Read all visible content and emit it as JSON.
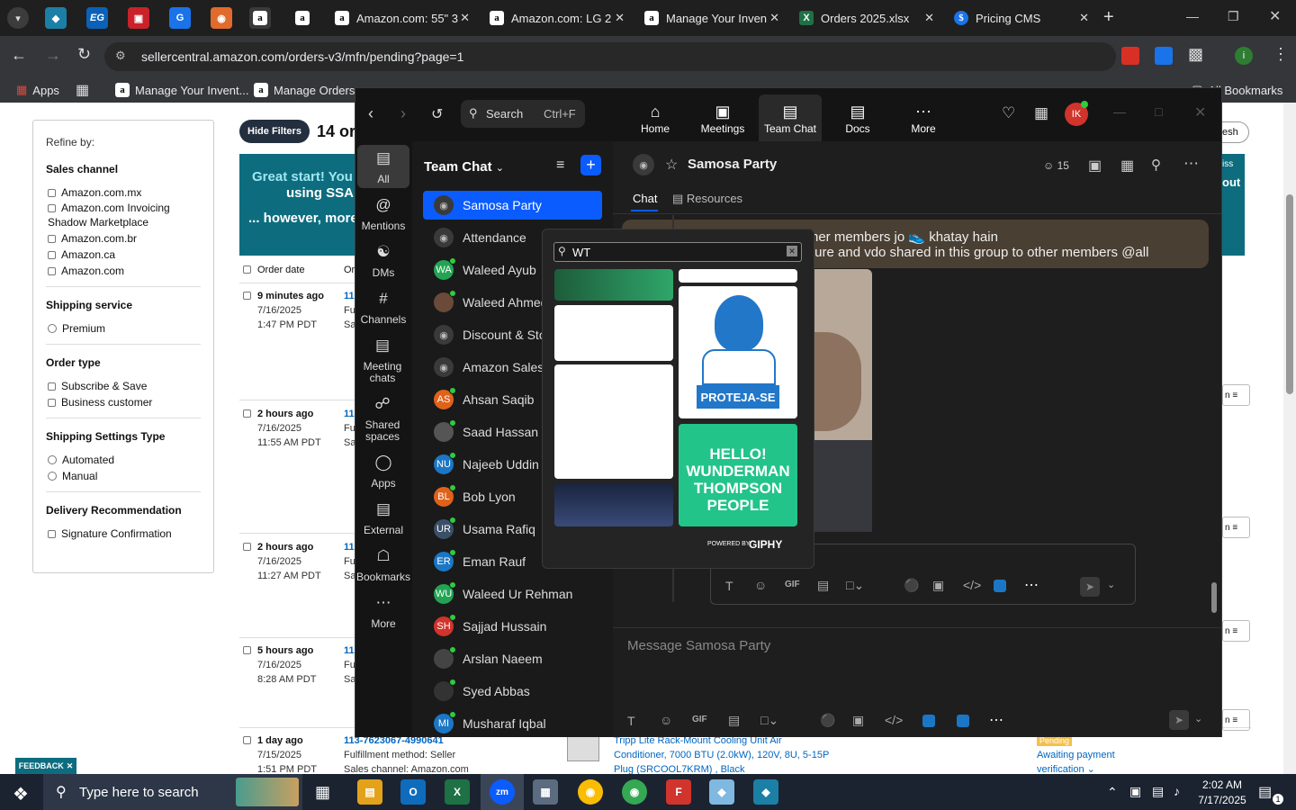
{
  "browser": {
    "tabs": [
      {
        "title": "Amazon.com: 55\" 3"
      },
      {
        "title": "Amazon.com: LG 2"
      },
      {
        "title": "Manage Your Inven"
      },
      {
        "title": "Orders 2025.xlsx"
      },
      {
        "title": "Pricing CMS"
      }
    ],
    "tab_icons": [
      "EG"
    ],
    "url": "sellercentral.amazon.com/orders-v3/mfn/pending?page=1",
    "bookmarks": [
      "Apps",
      "Manage Your Invent...",
      "Manage Orders",
      "All Bookmarks"
    ]
  },
  "seller": {
    "hide_filters": "Hide Filters",
    "count_prefix": "14 or",
    "banner_line1": "Great start! You",
    "banner_line2": "using SSA",
    "banner_line3": "... however, more",
    "refresh": "resh",
    "dismiss": "iss",
    "out": "out",
    "refine_by": "Refine by:",
    "filters": {
      "sales_channel": "Sales channel",
      "sales_channel_items": [
        "Amazon.com.mx",
        "Amazon.com Invoicing",
        "Shadow Marketplace",
        "Amazon.com.br",
        "Amazon.ca",
        "Amazon.com"
      ],
      "shipping_service": "Shipping service",
      "shipping_service_items": [
        "Premium"
      ],
      "order_type": "Order type",
      "order_type_items": [
        "Subscribe & Save",
        "Business customer"
      ],
      "shipping_settings": "Shipping Settings Type",
      "shipping_settings_items": [
        "Automated",
        "Manual"
      ],
      "delivery": "Delivery Recommendation",
      "delivery_items": [
        "Signature Confirmation"
      ]
    },
    "col_order_date": "Order date",
    "col_or": "Or",
    "orders": [
      {
        "age": "9 minutes ago",
        "date": "7/16/2025",
        "time": "1:47 PM PDT",
        "id": "11",
        "f": "Fu",
        "s": "Sa"
      },
      {
        "age": "2 hours ago",
        "date": "7/16/2025",
        "time": "11:55 AM PDT",
        "id": "11",
        "f": "Fu",
        "s": "Sa"
      },
      {
        "age": "2 hours ago",
        "date": "7/16/2025",
        "time": "11:27 AM PDT",
        "id": "11",
        "f": "Fu",
        "s": "Sa"
      },
      {
        "age": "5 hours ago",
        "date": "7/16/2025",
        "time": "8:28 AM PDT",
        "id": "11",
        "f": "Fu",
        "s": "Sa"
      },
      {
        "age": "1 day ago",
        "date": "7/15/2025",
        "time": "1:51 PM PDT",
        "id": "113-7623067-4990641",
        "f": "Fulfillment method: Seller",
        "s": "Sales channel: Amazon.com"
      }
    ],
    "row_right_labels": [
      "n",
      "n",
      "n",
      "n"
    ],
    "last_product": "Tripp Lite Rack-Mount Cooling Unit Air Conditioner, 7000 BTU (2.0kW), 120V, 8U, 5-15P Plug (SRCOOL7KRM) , Black",
    "pending_badge": "Pending",
    "awaiting": "Awaiting payment",
    "verification": "verification",
    "feedback": "FEEDBACK"
  },
  "zoom": {
    "search_label": "Search",
    "search_shortcut": "Ctrl+F",
    "nav": [
      {
        "label": "Home",
        "icon": "home-icon"
      },
      {
        "label": "Meetings",
        "icon": "camera-icon"
      },
      {
        "label": "Team Chat",
        "icon": "chat-icon"
      },
      {
        "label": "Docs",
        "icon": "doc-icon"
      },
      {
        "label": "More",
        "icon": "more-icon"
      }
    ],
    "avatar_initials": "IK",
    "rail": [
      "All",
      "Mentions",
      "DMs",
      "Channels",
      "Meeting chats",
      "Shared spaces",
      "Apps",
      "External",
      "Bookmarks",
      "More"
    ],
    "list_title": "Team Chat",
    "chats": [
      {
        "name": "Samosa Party",
        "initials": "",
        "color": "#0b5cff",
        "kind": "lock"
      },
      {
        "name": "Attendance",
        "initials": "",
        "color": "",
        "kind": "lock"
      },
      {
        "name": "Waleed Ayub",
        "initials": "WA",
        "color": "#23a455",
        "kind": "av"
      },
      {
        "name": "Waleed Ahmed",
        "initials": "",
        "color": "#6b4a3a",
        "kind": "photo"
      },
      {
        "name": "Discount & Stoc",
        "initials": "",
        "color": "",
        "kind": "lock"
      },
      {
        "name": "Amazon Sales T",
        "initials": "",
        "color": "",
        "kind": "lock"
      },
      {
        "name": "Ahsan Saqib",
        "initials": "AS",
        "color": "#e0621a",
        "kind": "av"
      },
      {
        "name": "Saad Hassan",
        "initials": "",
        "color": "#555",
        "kind": "photo"
      },
      {
        "name": "Najeeb Uddin",
        "initials": "NU",
        "color": "#1b77c5",
        "kind": "av"
      },
      {
        "name": "Bob Lyon",
        "initials": "BL",
        "color": "#e0621a",
        "kind": "av"
      },
      {
        "name": "Usama Rafiq",
        "initials": "UR",
        "color": "#3a5068",
        "kind": "av"
      },
      {
        "name": "Eman Rauf",
        "initials": "ER",
        "color": "#1b77c5",
        "kind": "av"
      },
      {
        "name": "Waleed Ur Rehman",
        "initials": "WU",
        "color": "#23a455",
        "kind": "av"
      },
      {
        "name": "Sajjad Hussain",
        "initials": "SH",
        "color": "#d0342c",
        "kind": "av"
      },
      {
        "name": "Arslan Naeem",
        "initials": "",
        "color": "#444",
        "kind": "photo"
      },
      {
        "name": "Syed Abbas",
        "initials": "",
        "color": "#333",
        "kind": "photo"
      },
      {
        "name": "Musharaf Iqbal",
        "initials": "MI",
        "color": "#1b77c5",
        "kind": "av"
      }
    ],
    "channel_name": "Samosa Party",
    "member_count": "15",
    "tab_chat": "Chat",
    "tab_resources": "Resources",
    "message_line1": "her members jo 👟 khatay hain",
    "message_line2": "ture and vdo shared in this group to other members @all",
    "gif_search_value": "WT",
    "gif1_text": "PROTEJA-SE",
    "gif2_text": "HELLO! WUNDERMAN THOMPSON PEOPLE",
    "powered_by": "POWERED BY",
    "giphy": "GIPHY",
    "composer_placeholder": "Message Samosa Party",
    "gif_label": "GIF"
  },
  "taskbar": {
    "search": "Type here to search",
    "time": "2:02 AM",
    "date": "7/17/2025",
    "notif": "1"
  }
}
